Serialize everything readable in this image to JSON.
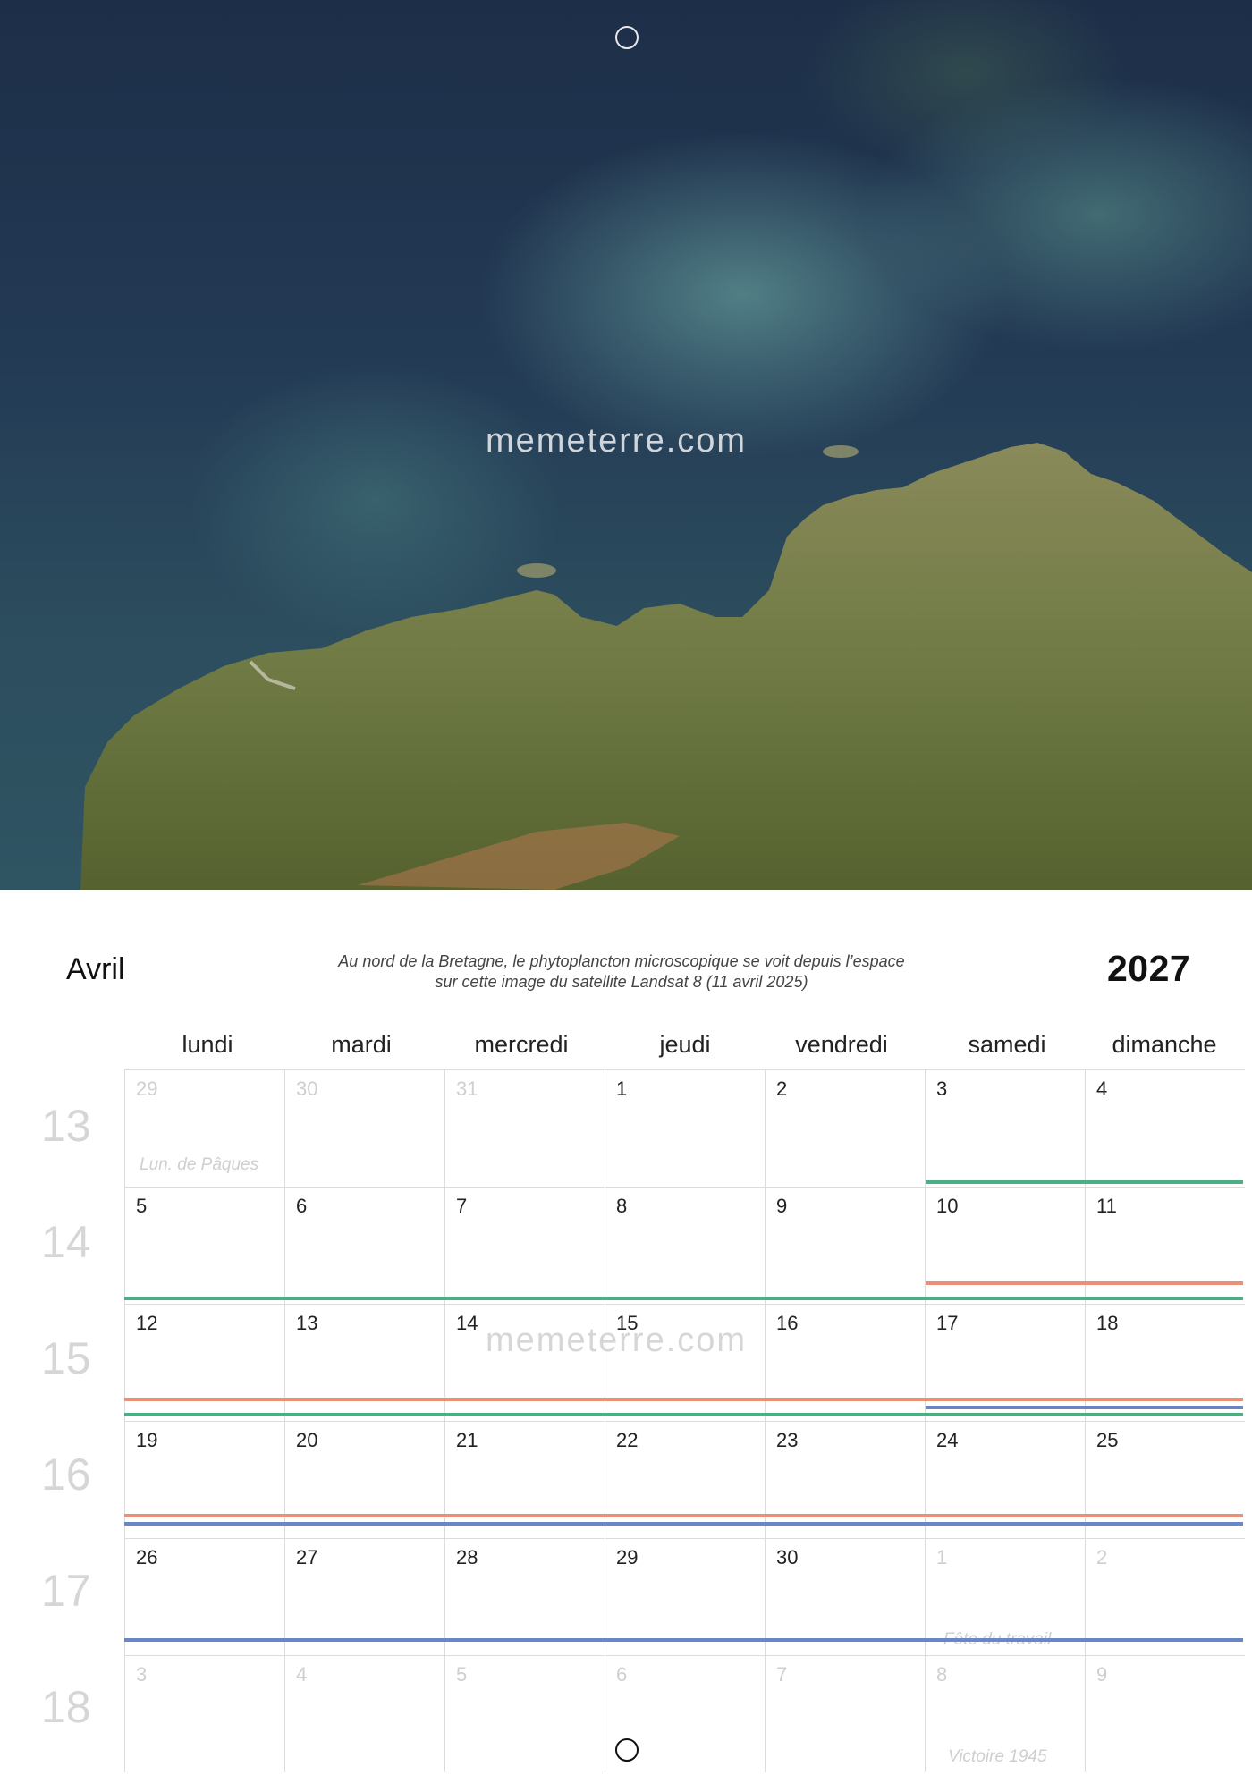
{
  "photo": {
    "watermark": "memeterre.com"
  },
  "header": {
    "month": "Avril",
    "year": "2027",
    "caption_line1": "Au nord de la Bretagne, le phytoplancton microscopique se voit depuis l’espace",
    "caption_line2": "sur cette image du satellite Landsat 8 (11 avril 2025)"
  },
  "calendar": {
    "weekdays": [
      "lundi",
      "mardi",
      "mercredi",
      "jeudi",
      "vendredi",
      "samedi",
      "dimanche"
    ],
    "week_numbers": [
      "13",
      "14",
      "15",
      "16",
      "17",
      "18"
    ],
    "weeks": [
      [
        "29",
        "30",
        "31",
        "1",
        "2",
        "3",
        "4"
      ],
      [
        "5",
        "6",
        "7",
        "8",
        "9",
        "10",
        "11"
      ],
      [
        "12",
        "13",
        "14",
        "15",
        "16",
        "17",
        "18"
      ],
      [
        "19",
        "20",
        "21",
        "22",
        "23",
        "24",
        "25"
      ],
      [
        "26",
        "27",
        "28",
        "29",
        "30",
        "1",
        "2"
      ],
      [
        "3",
        "4",
        "5",
        "6",
        "7",
        "8",
        "9"
      ]
    ],
    "holidays": {
      "paques": "Lun. de Pâques",
      "travail": "Fête du travail",
      "victoire": "Victoire 1945"
    },
    "watermark": "memeterre.com"
  },
  "colors": {
    "green": "#4caf84",
    "salmon": "#ec8f78",
    "blue": "#6b85c9",
    "grid": "#dcdcdc"
  }
}
